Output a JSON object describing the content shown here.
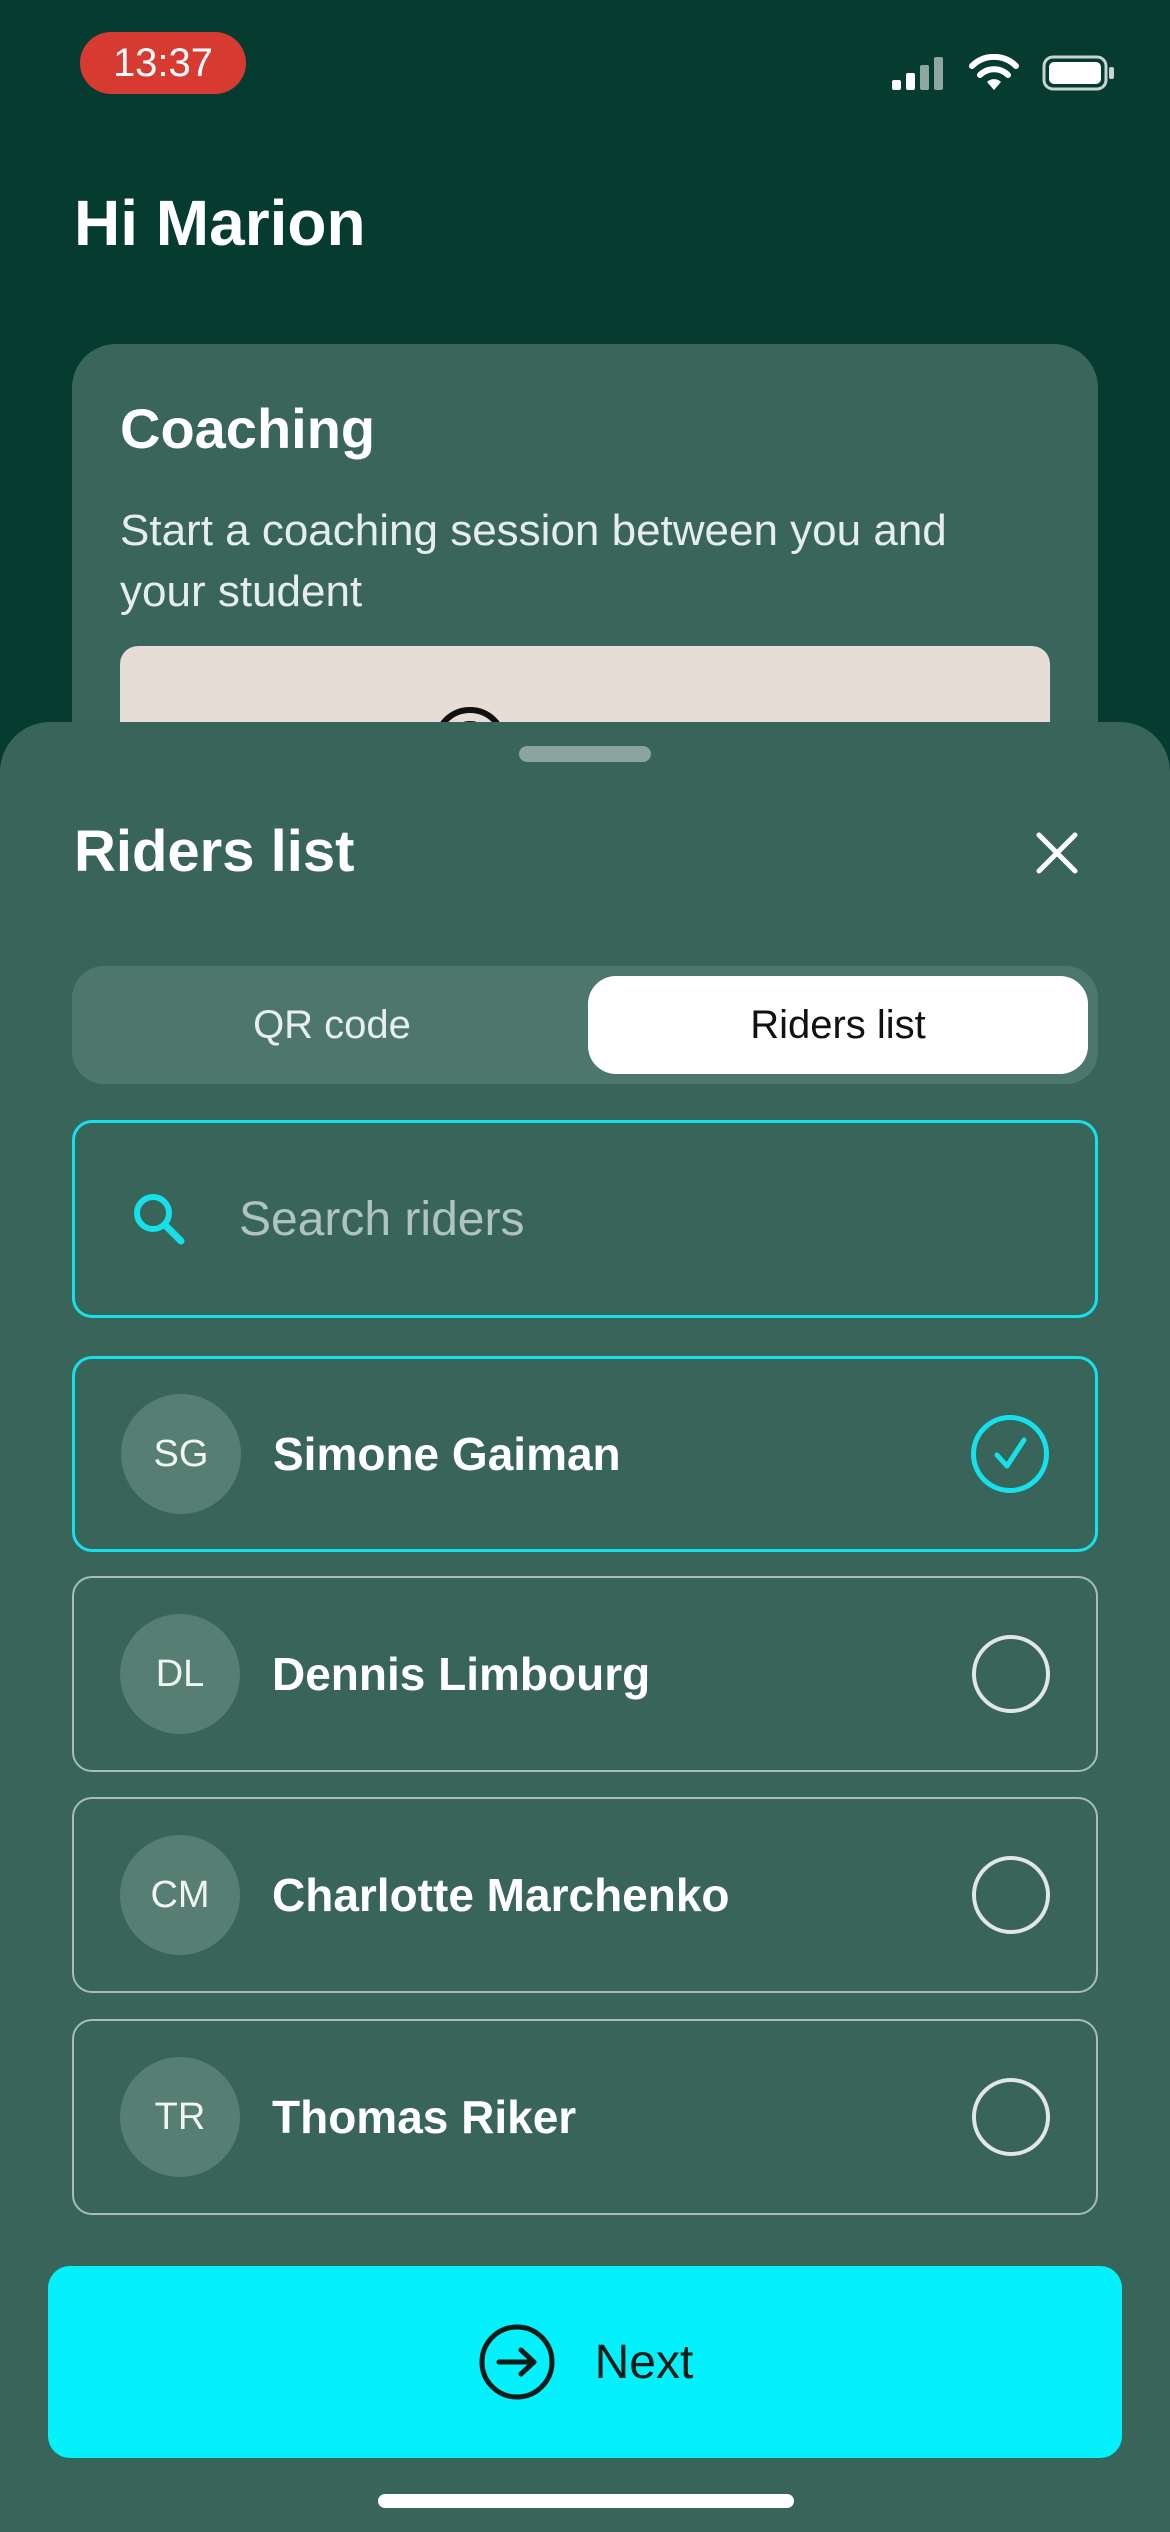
{
  "status_bar": {
    "time": "13:37",
    "time_pill_color": "#d73a31",
    "icons": [
      "cellular-signal-icon",
      "wifi-icon",
      "battery-icon"
    ]
  },
  "greeting": "Hi Marion",
  "coaching_card": {
    "title": "Coaching",
    "description": "Start a coaching session between you and your student"
  },
  "sheet": {
    "title": "Riders list",
    "close_icon": "close-icon",
    "segments": [
      {
        "label": "QR code",
        "selected": false
      },
      {
        "label": "Riders list",
        "selected": true
      }
    ],
    "search": {
      "placeholder": "Search riders",
      "value": ""
    },
    "riders": [
      {
        "initials": "SG",
        "name": "Simone Gaiman",
        "selected": true
      },
      {
        "initials": "DL",
        "name": "Dennis Limbourg",
        "selected": false
      },
      {
        "initials": "CM",
        "name": "Charlotte Marchenko",
        "selected": false
      },
      {
        "initials": "TR",
        "name": "Thomas Riker",
        "selected": false
      }
    ],
    "next_button": {
      "label": "Next",
      "icon": "arrow-right-circle-icon"
    }
  },
  "colors": {
    "background": "#053c2f",
    "sheet": "#386459",
    "accent": "#16e1ea",
    "primary_button": "#04f0fa"
  }
}
